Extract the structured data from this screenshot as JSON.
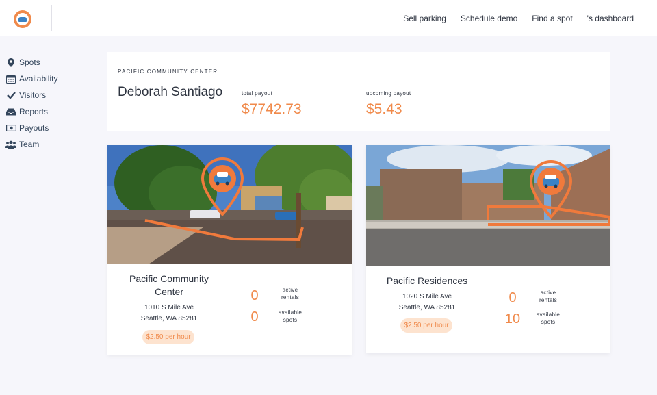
{
  "nav": {
    "items": [
      "Sell parking",
      "Schedule demo",
      "Find a spot",
      "'s dashboard"
    ]
  },
  "sidebar": {
    "items": [
      {
        "label": "Spots",
        "icon": "map-pin-icon"
      },
      {
        "label": "Availability",
        "icon": "calendar-icon"
      },
      {
        "label": "Visitors",
        "icon": "check-icon"
      },
      {
        "label": "Reports",
        "icon": "inbox-icon"
      },
      {
        "label": "Payouts",
        "icon": "money-bill-icon"
      },
      {
        "label": "Team",
        "icon": "users-icon"
      }
    ]
  },
  "header": {
    "org": "Pacific Community Center",
    "person": "Deborah Santiago",
    "total_payout_label": "total payout",
    "total_payout": "$7742.73",
    "upcoming_payout_label": "upcoming payout",
    "upcoming_payout": "$5.43"
  },
  "locations": [
    {
      "name_line1": "Pacific Community",
      "name_line2": "Center",
      "address_line1": "1010 S Mile Ave",
      "address_line2": "Seattle, WA 85281",
      "rate": "$2.50 per hour",
      "active_rentals": "0",
      "active_label_1": "active",
      "active_label_2": "rentals",
      "available_spots": "0",
      "available_label_1": "available",
      "available_label_2": "spots"
    },
    {
      "name_line1": "Pacific Residences",
      "address_line1": "1020 S Mile Ave",
      "address_line2": "Seattle, WA 85281",
      "rate": "$2.50 per hour",
      "active_rentals": "0",
      "active_label_1": "active",
      "active_label_2": "rentals",
      "available_spots": "10",
      "available_label_1": "available",
      "available_label_2": "spots"
    }
  ],
  "colors": {
    "accent": "#f08a4b",
    "rate_pill_bg": "#fde3cf",
    "sidebar_text": "#34465c",
    "page_bg": "#f6f6fb"
  }
}
